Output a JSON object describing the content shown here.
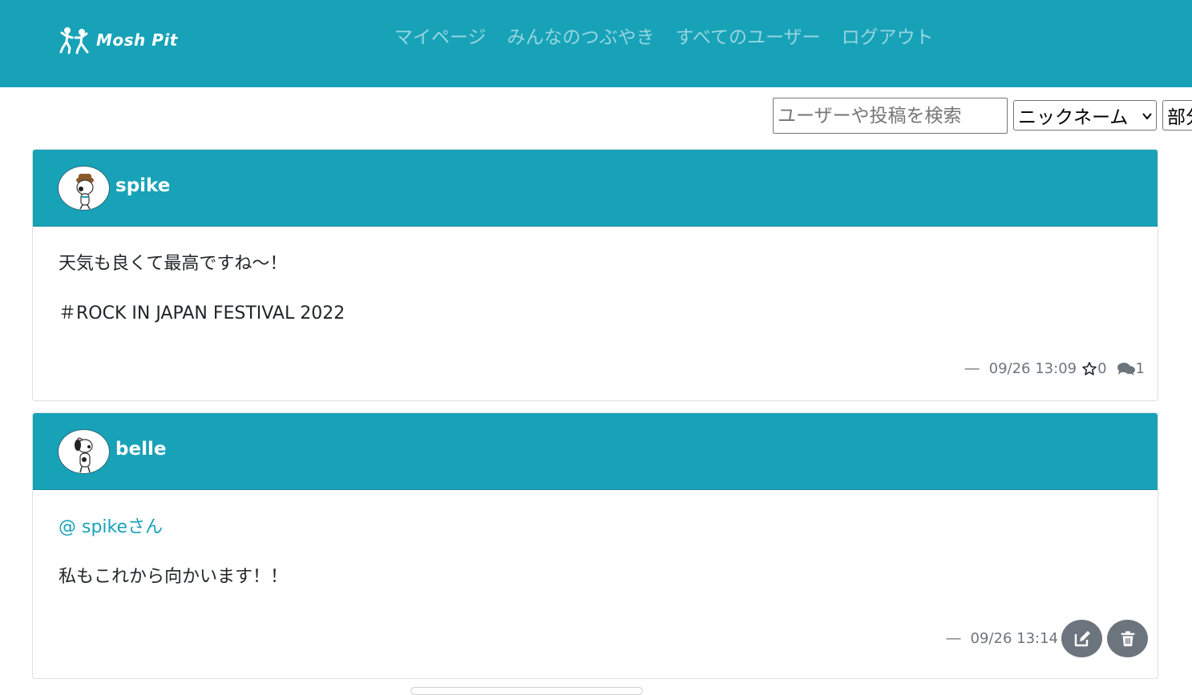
{
  "header": {
    "brand": "Mosh Pit",
    "nav": [
      {
        "label": "マイページ"
      },
      {
        "label": "みんなのつぶやき"
      },
      {
        "label": "すべてのユーザー"
      },
      {
        "label": "ログアウト"
      }
    ]
  },
  "search": {
    "placeholder": "ユーザーや投稿を検索",
    "type_select": "ニックネーム",
    "match_select": "部分一致"
  },
  "posts": [
    {
      "username": "spike",
      "lines": [
        "天気も良くて最高ですね～！",
        "＃ROCK IN JAPAN FESTIVAL 2022"
      ],
      "dash": "―",
      "timestamp": "09/26 13:09",
      "likes": "0",
      "comments": "1"
    },
    {
      "username": "belle",
      "mention": "@ spikeさん",
      "lines": [
        "私もこれから向かいます！！"
      ],
      "dash": "―",
      "timestamp": "09/26 13:14"
    }
  ],
  "colors": {
    "primary": "#17a2b8",
    "secondary": "#6c757d"
  }
}
